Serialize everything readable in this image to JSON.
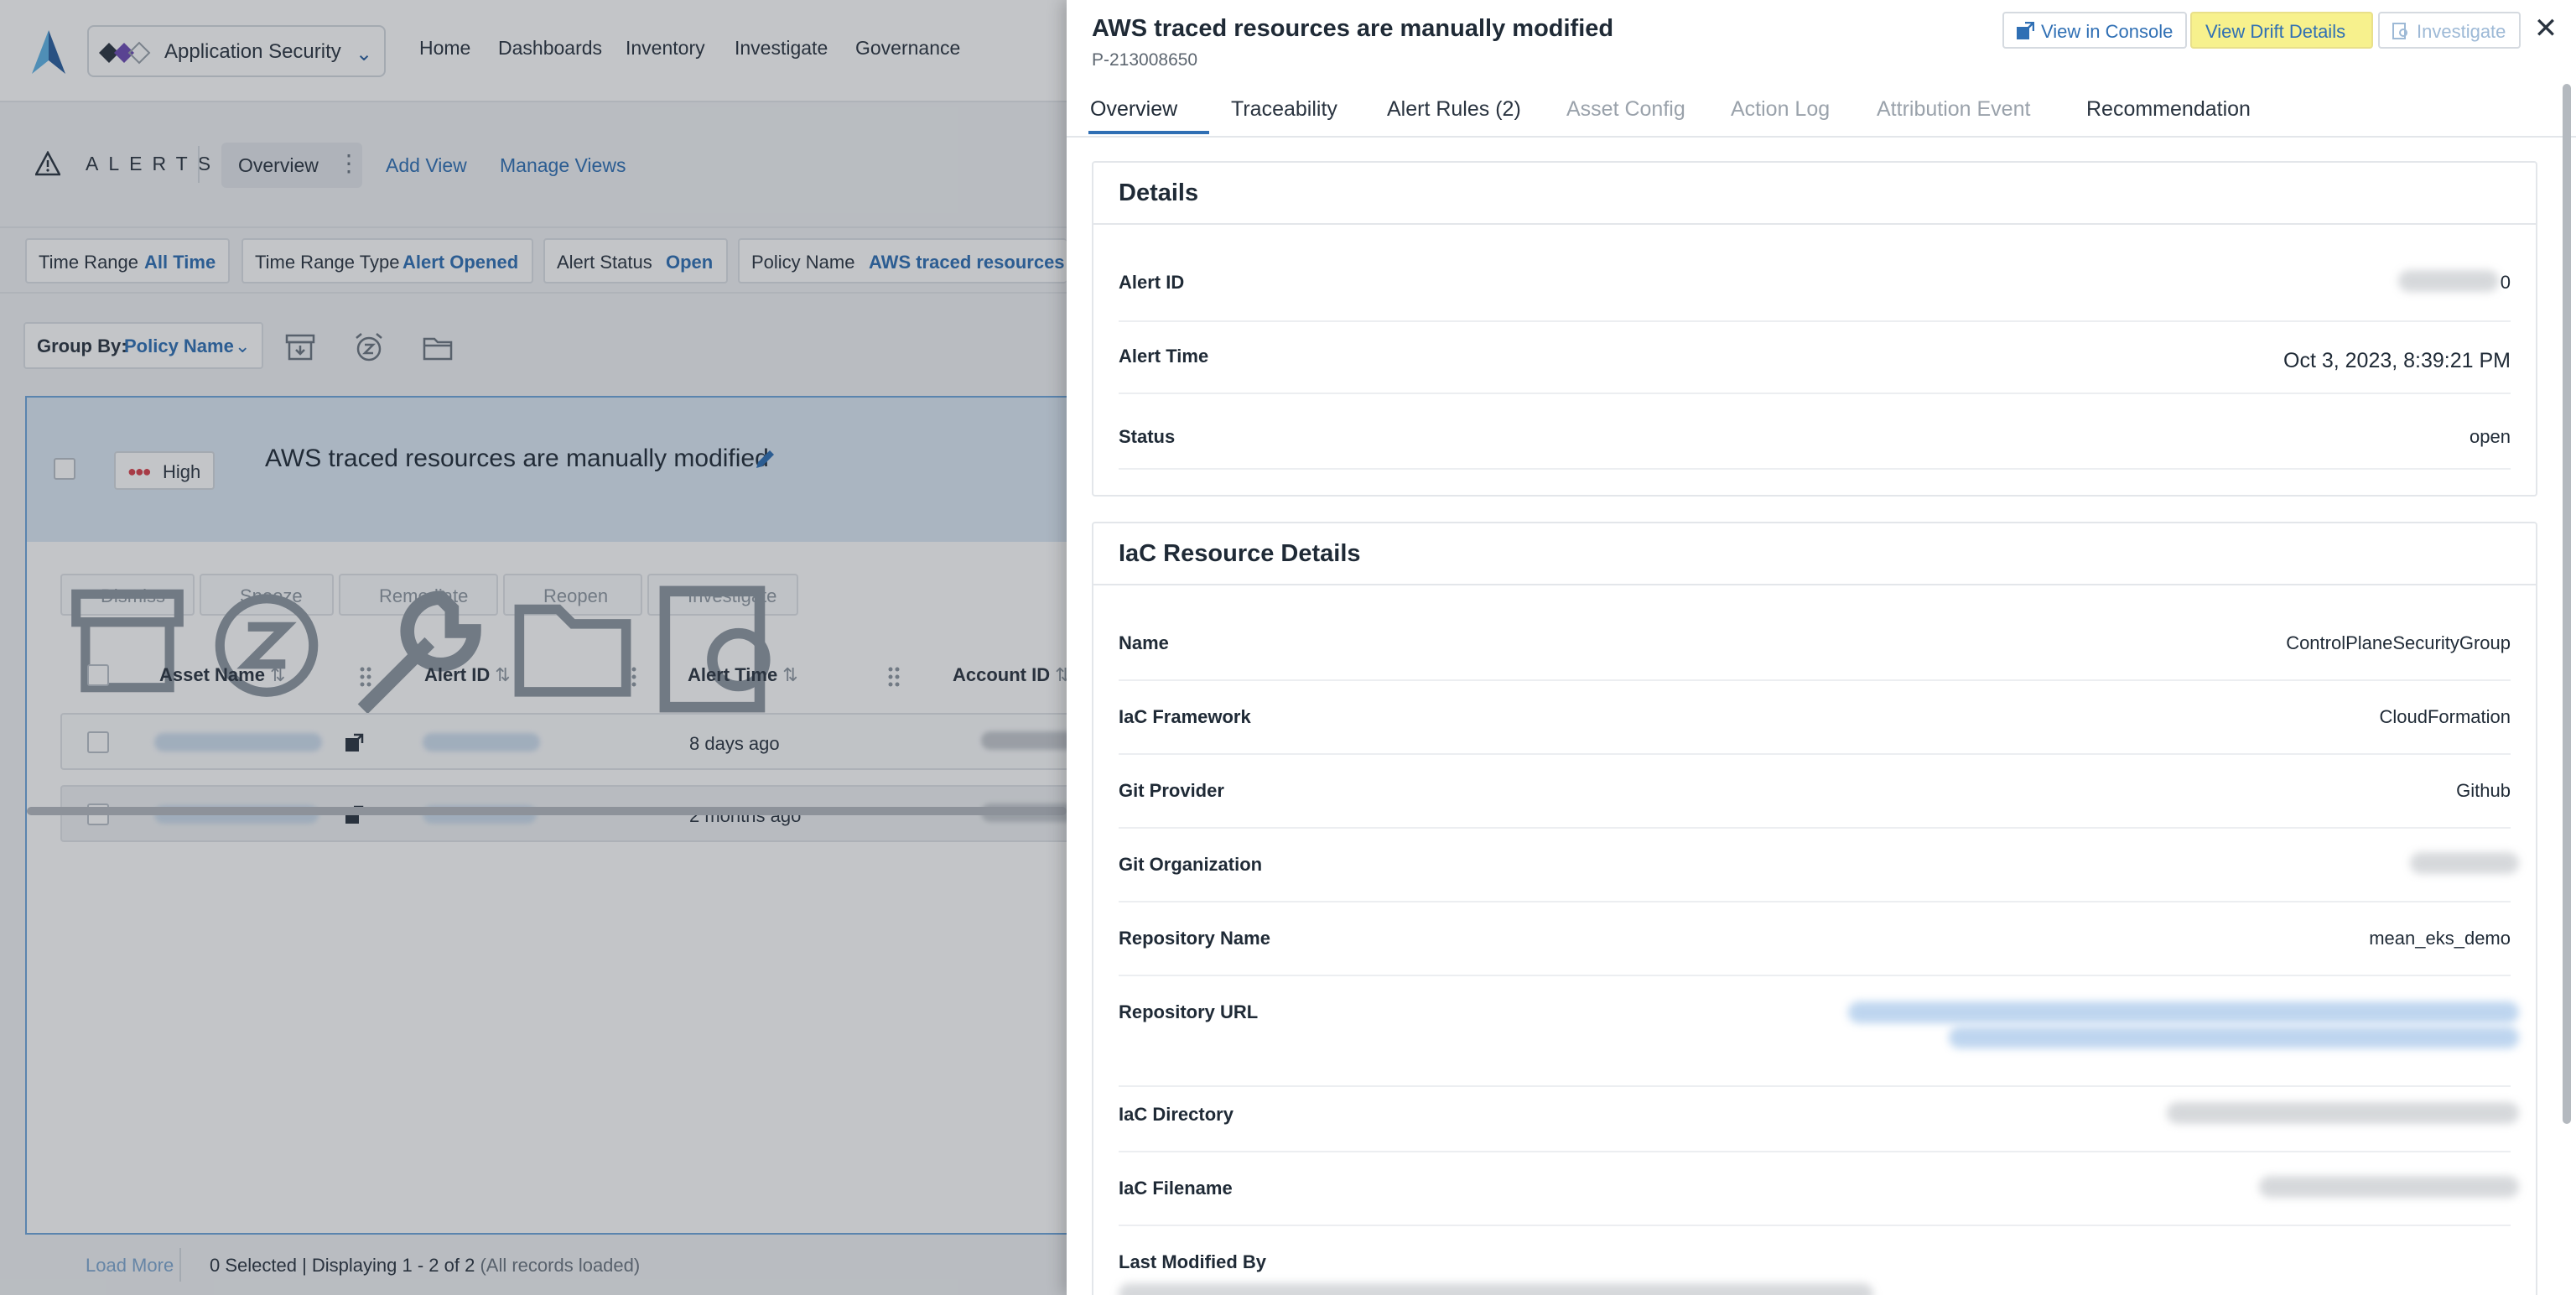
{
  "app": {
    "switcher_label": "Application Security",
    "nav": [
      "Home",
      "Dashboards",
      "Inventory",
      "Investigate",
      "Governance"
    ]
  },
  "alerts_page": {
    "title": "ALERTS",
    "overview_tab": "Overview",
    "add_view": "Add View",
    "manage_views": "Manage Views",
    "filters": [
      {
        "label": "Time Range",
        "value": "All Time"
      },
      {
        "label": "Time Range Type",
        "value": "Alert Opened"
      },
      {
        "label": "Alert Status",
        "value": "Open"
      },
      {
        "label": "Policy Name",
        "value": "AWS traced resources ar"
      }
    ],
    "group_by_label": "Group By:",
    "group_by_value": "Policy Name",
    "card": {
      "severity": "High",
      "title": "AWS traced resources are manually modified",
      "actions": [
        "Dismiss",
        "Snooze",
        "Remediate",
        "Reopen",
        "Investigate"
      ],
      "columns": [
        "Asset Name",
        "Alert ID",
        "Alert Time",
        "Account ID"
      ],
      "rows": [
        {
          "alert_time": "8 days ago"
        },
        {
          "alert_time": "2 months ago"
        }
      ]
    },
    "footer": {
      "load_more": "Load More",
      "selected": "0 Selected | Displaying 1 - 2 of 2",
      "loaded": "(All records loaded)"
    }
  },
  "drawer": {
    "title": "AWS traced resources are manually modified",
    "policy_id": "P-213008650",
    "buttons": {
      "view_console": "View in Console",
      "view_drift": "View Drift Details",
      "investigate": "Investigate"
    },
    "tabs": [
      {
        "label": "Overview",
        "state": "active"
      },
      {
        "label": "Traceability",
        "state": "enabled"
      },
      {
        "label": "Alert Rules (2)",
        "state": "enabled"
      },
      {
        "label": "Asset Config",
        "state": "disabled"
      },
      {
        "label": "Action Log",
        "state": "disabled"
      },
      {
        "label": "Attribution Event",
        "state": "disabled"
      },
      {
        "label": "Recommendation",
        "state": "enabled"
      }
    ],
    "details": {
      "title": "Details",
      "alert_id_label": "Alert ID",
      "alert_id_suffix": "0",
      "alert_time_label": "Alert Time",
      "alert_time_value": "Oct 3, 2023, 8:39:21 PM",
      "status_label": "Status",
      "status_value": "open"
    },
    "iac": {
      "title": "IaC Resource Details",
      "fields": [
        {
          "label": "Name",
          "value": "ControlPlaneSecurityGroup"
        },
        {
          "label": "IaC Framework",
          "value": "CloudFormation"
        },
        {
          "label": "Git Provider",
          "value": "Github"
        },
        {
          "label": "Git Organization",
          "value": ""
        },
        {
          "label": "Repository Name",
          "value": "mean_eks_demo"
        },
        {
          "label": "Repository URL",
          "value": ""
        },
        {
          "label": "IaC Directory",
          "value": ""
        },
        {
          "label": "IaC Filename",
          "value": ""
        },
        {
          "label": "Last Modified By",
          "value": ""
        }
      ]
    }
  },
  "colors": {
    "accent": "#2f6fb4",
    "highlight": "#f7f18d",
    "severity_high": "#d9414b"
  }
}
